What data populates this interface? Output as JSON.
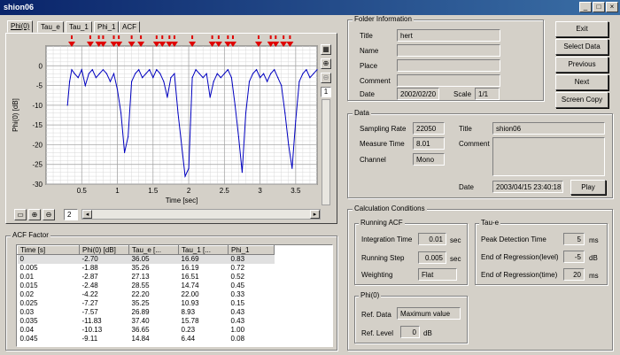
{
  "window": {
    "title": "shion06"
  },
  "tabs": [
    "Phi(0)",
    "Tau_e",
    "Tau_1",
    "Phi_1",
    "ACF"
  ],
  "plot": {
    "ylabel": "Phi(0) [dB]",
    "xlabel": "Time [sec]",
    "ytick_labels": [
      "0",
      "-5",
      "-10",
      "-15",
      "-20",
      "-25",
      "-30"
    ],
    "xtick_labels": [
      "0.5",
      "1",
      "1.5",
      "2",
      "2.5",
      "3",
      "3.5"
    ],
    "marker_label": "I",
    "zoom_value": "2",
    "side_value": "1"
  },
  "chart_data": {
    "type": "line",
    "xlabel": "Time [sec]",
    "ylabel": "Phi(0) [dB]",
    "xlim": [
      0,
      3.8
    ],
    "ylim": [
      -30,
      5
    ],
    "markers_x": [
      0.36,
      0.62,
      0.74,
      0.8,
      0.95,
      1.02,
      1.2,
      1.33,
      1.55,
      1.63,
      1.73,
      1.8,
      2.05,
      2.33,
      2.42,
      2.55,
      2.62,
      2.98,
      3.15,
      3.22,
      3.33,
      3.42
    ],
    "series": [
      {
        "x": [
          0.3,
          0.33,
          0.36,
          0.4,
          0.45,
          0.5,
          0.55,
          0.6,
          0.65,
          0.7,
          0.75,
          0.8,
          0.85,
          0.9,
          0.95,
          1.0,
          1.05,
          1.1,
          1.15,
          1.2,
          1.25,
          1.3,
          1.35,
          1.4,
          1.45,
          1.5,
          1.55,
          1.6,
          1.65,
          1.7,
          1.75,
          1.8,
          1.85,
          1.9,
          1.95,
          2.0,
          2.05,
          2.1,
          2.15,
          2.2,
          2.25,
          2.3,
          2.35,
          2.4,
          2.45,
          2.5,
          2.55,
          2.6,
          2.65,
          2.7,
          2.75,
          2.8,
          2.85,
          2.9,
          2.95,
          3.0,
          3.05,
          3.1,
          3.15,
          3.2,
          3.25,
          3.3,
          3.35,
          3.4,
          3.45,
          3.5,
          3.55,
          3.6,
          3.65,
          3.7,
          3.75,
          3.8
        ],
        "y": [
          -10,
          -4,
          -1,
          -2,
          -3,
          -1,
          -5,
          -2,
          -1,
          -3,
          -2,
          -1,
          -2,
          -4,
          -2,
          -6,
          -12,
          -22,
          -18,
          -4,
          -2,
          -1,
          -3,
          -2,
          -1,
          -3,
          -1,
          -2,
          -4,
          -8,
          -3,
          -2,
          -12,
          -20,
          -28,
          -26,
          -3,
          -1,
          -2,
          -3,
          -2,
          -8,
          -4,
          -2,
          -3,
          -2,
          -1,
          -3,
          -10,
          -18,
          -27,
          -12,
          -4,
          -2,
          -1,
          -3,
          -2,
          -4,
          -2,
          -1,
          -3,
          -5,
          -12,
          -20,
          -26,
          -14,
          -4,
          -2,
          -1,
          -3,
          -2,
          -1
        ]
      }
    ]
  },
  "acf_factor": {
    "title": "ACF Factor",
    "headers": [
      "Time [s]",
      "Phi(0) [dB]",
      "Tau_e [...",
      "Tau_1 [...",
      "Phi_1"
    ],
    "rows": [
      [
        "0",
        "-2.70",
        "36.05",
        "16.69",
        "0.83"
      ],
      [
        "0.005",
        "-1.88",
        "35.26",
        "16.19",
        "0.72"
      ],
      [
        "0.01",
        "-2.87",
        "27.13",
        "16.51",
        "0.52"
      ],
      [
        "0.015",
        "-2.48",
        "28.55",
        "14.74",
        "0.45"
      ],
      [
        "0.02",
        "-4.22",
        "22.20",
        "22.00",
        "0.33"
      ],
      [
        "0.025",
        "-7.27",
        "35.25",
        "10.93",
        "0.15"
      ],
      [
        "0.03",
        "-7.57",
        "26.89",
        "8.93",
        "0.43"
      ],
      [
        "0.035",
        "-11.83",
        "37.40",
        "15.78",
        "0.43"
      ],
      [
        "0.04",
        "-10.13",
        "36.65",
        "0.23",
        "1.00"
      ],
      [
        "0.045",
        "-9.11",
        "14.84",
        "6.44",
        "0.08"
      ]
    ]
  },
  "folder_info": {
    "title": "Folder Information",
    "title_label": "Title",
    "title_value": "hert",
    "name_label": "Name",
    "name_value": "",
    "place_label": "Place",
    "place_value": "",
    "comment_label": "Comment",
    "comment_value": "",
    "date_label": "Date",
    "date_value": "2002/02/20",
    "scale_label": "Scale",
    "scale_value": "1/1"
  },
  "buttons": {
    "exit": "Exit",
    "select_data": "Select Data",
    "previous": "Previous",
    "next": "Next",
    "screen_copy": "Screen Copy",
    "play": "Play"
  },
  "data_panel": {
    "title": "Data",
    "sampling_rate_label": "Sampling Rate",
    "sampling_rate": "22050",
    "measure_time_label": "Measure Time",
    "measure_time": "8.01",
    "channel_label": "Channel",
    "channel": "Mono",
    "title_label": "Title",
    "title_value": "shion06",
    "comment_label": "Comment",
    "date_label": "Date",
    "date_value": "2003/04/15 23:40:18"
  },
  "calc": {
    "title": "Calculation Conditions",
    "running_acf": {
      "title": "Running ACF",
      "integration_time_label": "Integration Time",
      "integration_time": "0.01",
      "integration_unit": "sec",
      "running_step_label": "Running Step",
      "running_step": "0.005",
      "running_step_unit": "sec",
      "weighting_label": "Weighting",
      "weighting": "Flat"
    },
    "tau_e": {
      "title": "Tau-e",
      "peak_label": "Peak Detection Time",
      "peak": "5",
      "peak_unit": "ms",
      "end_level_label": "End of Regression(level)",
      "end_level": "-5",
      "end_level_unit": "dB",
      "end_time_label": "End of Regression(time)",
      "end_time": "20",
      "end_time_unit": "ms"
    },
    "phi0": {
      "title": "Phi(0)",
      "ref_data_label": "Ref. Data",
      "ref_data": "Maximum value",
      "ref_level_label": "Ref. Level",
      "ref_level": "0",
      "ref_level_unit": "dB"
    }
  },
  "colors": {
    "titlebar": "#0a246a",
    "trace": "#0000c0",
    "marker": "#e00000",
    "face": "#d4d0c8"
  }
}
